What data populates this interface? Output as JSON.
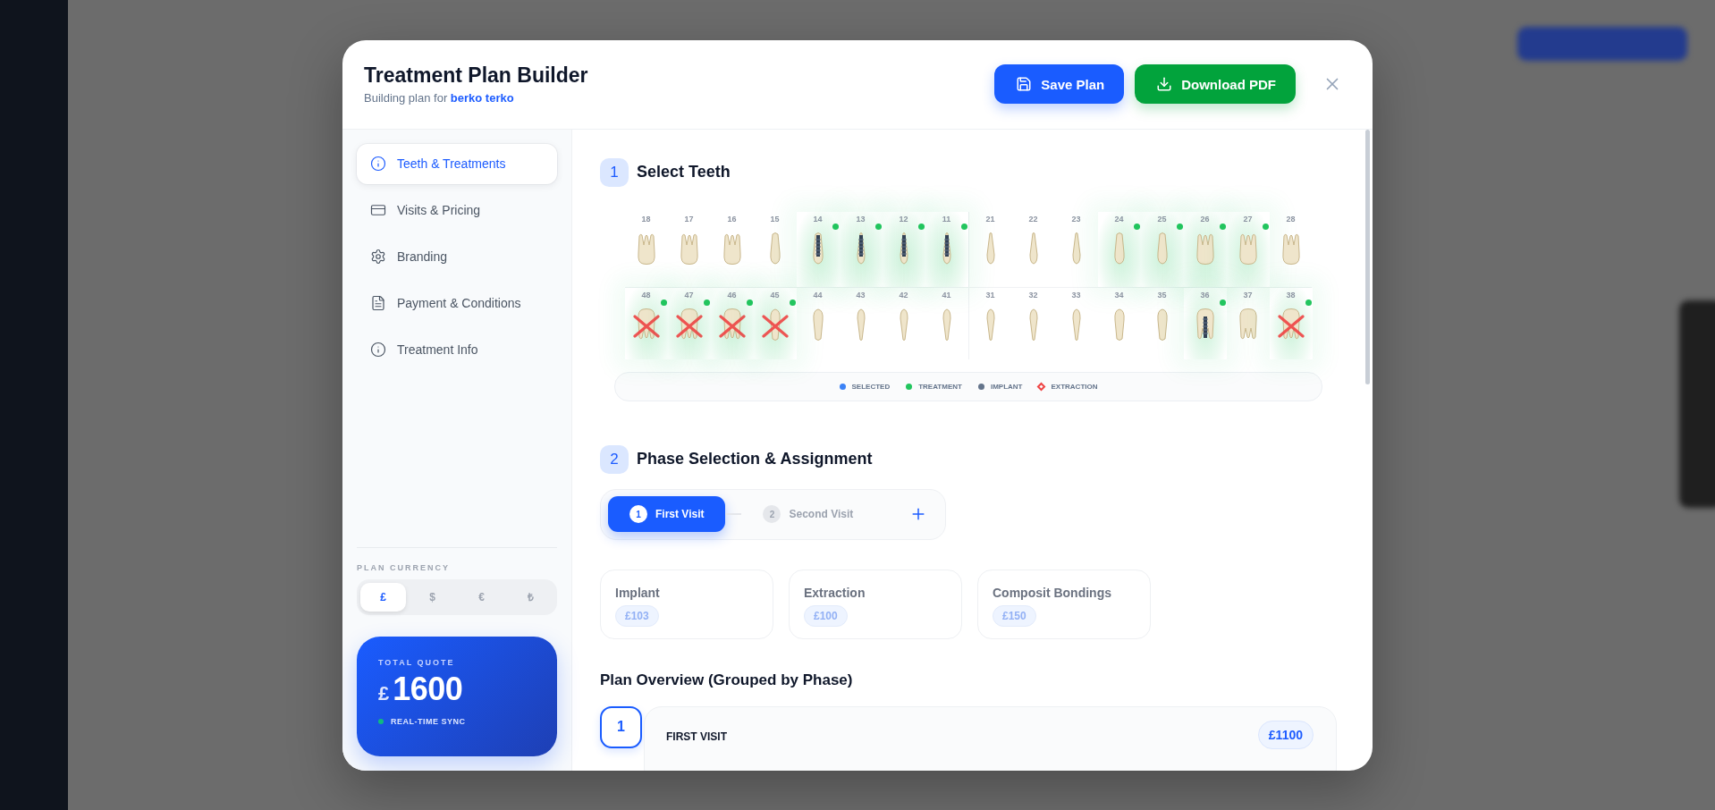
{
  "header": {
    "title": "Treatment Plan Builder",
    "subtitle": "Building plan for **berko terko**"
  },
  "actions": [
    {
      "label": "Save Plan",
      "kind": "save"
    },
    {
      "label": "Download PDF",
      "kind": "download"
    }
  ],
  "nav": [
    {
      "label": "Teeth & Treatments",
      "kind": "info",
      "selected": true
    },
    {
      "label": "Visits & Pricing",
      "kind": "card",
      "selected": false
    },
    {
      "label": "Branding",
      "kind": "gear",
      "selected": false
    },
    {
      "label": "Payment & Conditions",
      "kind": "document",
      "selected": false
    },
    {
      "label": "Treatment Info",
      "kind": "info",
      "selected": false
    }
  ],
  "currency": {
    "label": "PLAN CURRENCY",
    "options": [
      {
        "symbol": "£",
        "selected": true
      },
      {
        "symbol": "$",
        "selected": false
      },
      {
        "symbol": "€",
        "selected": false
      },
      {
        "symbol": "₺",
        "selected": false
      }
    ]
  },
  "total": {
    "label": "TOTAL QUOTE",
    "symbol": "£",
    "amount": "1600",
    "status": "REAL-TIME SYNC"
  },
  "select_teeth": {
    "number": "1",
    "title": "Select Teeth",
    "upper": [
      {
        "number": "18",
        "treatment": false,
        "implant": false,
        "extraction": false
      },
      {
        "number": "17",
        "treatment": false,
        "implant": false,
        "extraction": false
      },
      {
        "number": "16",
        "treatment": false,
        "implant": false,
        "extraction": false
      },
      {
        "number": "15",
        "treatment": false,
        "implant": false,
        "extraction": false
      },
      {
        "number": "14",
        "treatment": true,
        "implant": true,
        "extraction": false
      },
      {
        "number": "13",
        "treatment": true,
        "implant": true,
        "extraction": false
      },
      {
        "number": "12",
        "treatment": true,
        "implant": true,
        "extraction": false
      },
      {
        "number": "11",
        "treatment": true,
        "implant": true,
        "extraction": false
      },
      {
        "number": "21",
        "treatment": false,
        "implant": false,
        "extraction": false
      },
      {
        "number": "22",
        "treatment": false,
        "implant": false,
        "extraction": false
      },
      {
        "number": "23",
        "treatment": false,
        "implant": false,
        "extraction": false
      },
      {
        "number": "24",
        "treatment": true,
        "implant": false,
        "extraction": false
      },
      {
        "number": "25",
        "treatment": true,
        "implant": false,
        "extraction": false
      },
      {
        "number": "26",
        "treatment": true,
        "implant": false,
        "extraction": false
      },
      {
        "number": "27",
        "treatment": true,
        "implant": false,
        "extraction": false
      },
      {
        "number": "28",
        "treatment": false,
        "implant": false,
        "extraction": false
      }
    ],
    "lower": [
      {
        "number": "48",
        "treatment": true,
        "implant": false,
        "extraction": true
      },
      {
        "number": "47",
        "treatment": true,
        "implant": false,
        "extraction": true
      },
      {
        "number": "46",
        "treatment": true,
        "implant": false,
        "extraction": true
      },
      {
        "number": "45",
        "treatment": true,
        "implant": false,
        "extraction": true
      },
      {
        "number": "44",
        "treatment": false,
        "implant": false,
        "extraction": false
      },
      {
        "number": "43",
        "treatment": false,
        "implant": false,
        "extraction": false
      },
      {
        "number": "42",
        "treatment": false,
        "implant": false,
        "extraction": false
      },
      {
        "number": "41",
        "treatment": false,
        "implant": false,
        "extraction": false
      },
      {
        "number": "31",
        "treatment": false,
        "implant": false,
        "extraction": false
      },
      {
        "number": "32",
        "treatment": false,
        "implant": false,
        "extraction": false
      },
      {
        "number": "33",
        "treatment": false,
        "implant": false,
        "extraction": false
      },
      {
        "number": "34",
        "treatment": false,
        "implant": false,
        "extraction": false
      },
      {
        "number": "35",
        "treatment": false,
        "implant": false,
        "extraction": false
      },
      {
        "number": "36",
        "treatment": true,
        "implant": true,
        "extraction": false
      },
      {
        "number": "37",
        "treatment": false,
        "implant": false,
        "extraction": false
      },
      {
        "number": "38",
        "treatment": true,
        "implant": false,
        "extraction": true
      }
    ],
    "legend": [
      {
        "label": "SELECTED",
        "kind": "dot",
        "color": "#3b82f6"
      },
      {
        "label": "TREATMENT",
        "kind": "dot",
        "color": "#22c55e"
      },
      {
        "label": "IMPLANT",
        "kind": "dot",
        "color": "#64748b"
      },
      {
        "label": "EXTRACTION",
        "kind": "diamond",
        "color": "#ef4444"
      }
    ]
  },
  "phase_selection": {
    "number": "2",
    "title": "Phase Selection & Assignment",
    "phases": [
      {
        "number": "1",
        "label": "First Visit",
        "selected": true
      },
      {
        "number": "2",
        "label": "Second Visit",
        "selected": false
      }
    ],
    "treatments": [
      {
        "name": "Implant",
        "price": "£103"
      },
      {
        "name": "Extraction",
        "price": "£100"
      },
      {
        "name": "Composit Bondings",
        "price": "£150"
      }
    ]
  },
  "overview": {
    "title": "Plan Overview (Grouped by Phase)",
    "phases": [
      {
        "number": "1",
        "name": "FIRST VISIT",
        "total": "£1100"
      }
    ]
  }
}
